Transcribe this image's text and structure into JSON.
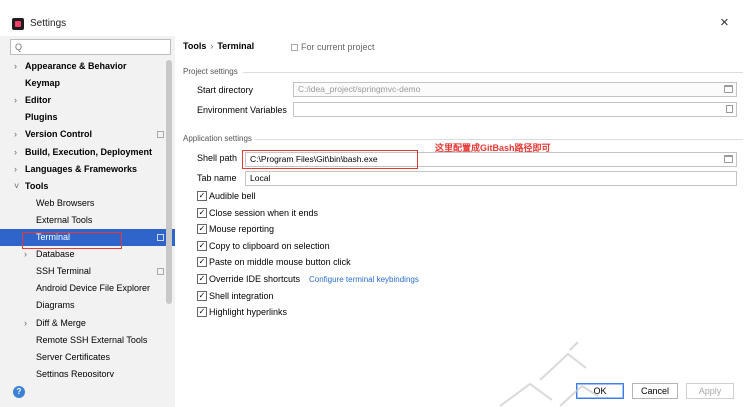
{
  "window": {
    "title": "Settings",
    "close_icon": "×"
  },
  "search": {
    "icon": "Q",
    "placeholder": ""
  },
  "sidebar": {
    "items": [
      {
        "label": "Appearance & Behavior",
        "level": 0,
        "expandable": true,
        "arrow": "›"
      },
      {
        "label": "Keymap",
        "level": 0,
        "expandable": false,
        "arrow": ""
      },
      {
        "label": "Editor",
        "level": 0,
        "expandable": true,
        "arrow": "›"
      },
      {
        "label": "Plugins",
        "level": 0,
        "expandable": false,
        "arrow": ""
      },
      {
        "label": "Version Control",
        "level": 0,
        "expandable": true,
        "arrow": "›"
      },
      {
        "label": "Build, Execution, Deployment",
        "level": 0,
        "expandable": true,
        "arrow": "›"
      },
      {
        "label": "Languages & Frameworks",
        "level": 0,
        "expandable": true,
        "arrow": "›"
      },
      {
        "label": "Tools",
        "level": 0,
        "expandable": true,
        "arrow": "˅"
      },
      {
        "label": "Web Browsers",
        "level": 1,
        "expandable": false,
        "arrow": ""
      },
      {
        "label": "External Tools",
        "level": 1,
        "expandable": false,
        "arrow": ""
      },
      {
        "label": "Terminal",
        "level": 1,
        "expandable": false,
        "arrow": "",
        "selected": true
      },
      {
        "label": "Database",
        "level": 1,
        "expandable": true,
        "arrow": "›"
      },
      {
        "label": "SSH Terminal",
        "level": 1,
        "expandable": false,
        "arrow": ""
      },
      {
        "label": "Android Device File Explorer",
        "level": 1,
        "expandable": false,
        "arrow": ""
      },
      {
        "label": "Diagrams",
        "level": 1,
        "expandable": false,
        "arrow": ""
      },
      {
        "label": "Diff & Merge",
        "level": 1,
        "expandable": true,
        "arrow": "›"
      },
      {
        "label": "Remote SSH External Tools",
        "level": 1,
        "expandable": false,
        "arrow": ""
      },
      {
        "label": "Server Certificates",
        "level": 1,
        "expandable": false,
        "arrow": ""
      },
      {
        "label": "Settings Repository",
        "level": 1,
        "expandable": false,
        "arrow": ""
      }
    ]
  },
  "main": {
    "breadcrumb": {
      "parent": "Tools",
      "separator": "›",
      "current": "Terminal"
    },
    "scope_label": "For current project",
    "project_settings": {
      "title": "Project settings",
      "start_directory_label": "Start directory",
      "start_directory_value": "C:/idea_project/springmvc-demo",
      "env_vars_label": "Environment Variables",
      "env_vars_value": ""
    },
    "application_settings": {
      "title": "Application settings",
      "shell_path_label": "Shell path",
      "shell_path_value": "C:\\Program Files\\Git\\bin\\bash.exe",
      "annotation": "这里配置成GitBash路径即可",
      "tab_name_label": "Tab name",
      "tab_name_value": "Local",
      "checkboxes": [
        {
          "label": "Audible bell",
          "checked": true,
          "mark": "✓"
        },
        {
          "label": "Close session when it ends",
          "checked": true,
          "mark": "✓"
        },
        {
          "label": "Mouse reporting",
          "checked": true,
          "mark": "✓"
        },
        {
          "label": "Copy to clipboard on selection",
          "checked": true,
          "mark": "✓"
        },
        {
          "label": "Paste on middle mouse button click",
          "checked": true,
          "mark": "✓"
        },
        {
          "label": "Override IDE shortcuts",
          "checked": true,
          "mark": "✓",
          "link": "Configure terminal keybindings"
        },
        {
          "label": "Shell integration",
          "checked": true,
          "mark": "✓"
        },
        {
          "label": "Highlight hyperlinks",
          "checked": true,
          "mark": "✓"
        }
      ]
    }
  },
  "footer": {
    "help_icon": "?",
    "ok_label": "OK",
    "cancel_label": "Cancel",
    "apply_label": "Apply"
  },
  "colors": {
    "selection": "#2f65ca",
    "annotation": "#e53935",
    "link": "#2b6ed0",
    "ok_border": "#3f7ee8"
  }
}
